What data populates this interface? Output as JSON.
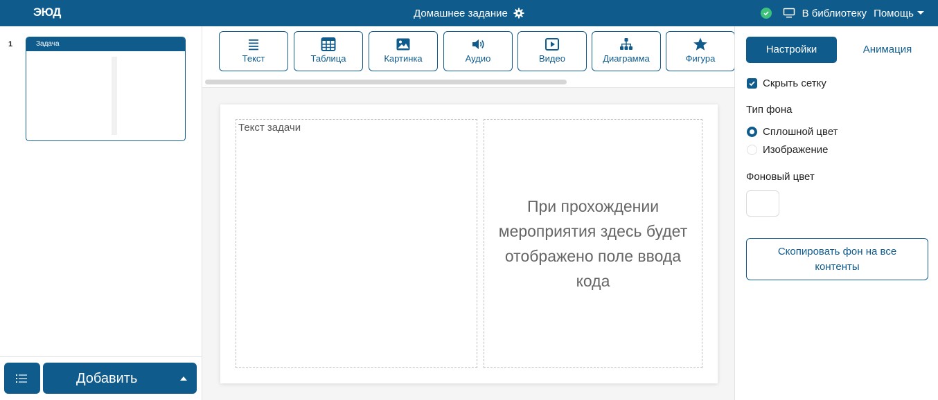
{
  "header": {
    "logo": "ЭЮД",
    "title": "Домашнее задание",
    "library_link": "В библиотеку",
    "help_menu": "Помощь"
  },
  "sidebar": {
    "slides": [
      {
        "number": "1",
        "title": "Задача"
      }
    ],
    "add_button": "Добавить"
  },
  "toolbar": {
    "tools": [
      {
        "label": "Текст",
        "icon": "lines-icon"
      },
      {
        "label": "Таблица",
        "icon": "table-icon"
      },
      {
        "label": "Картинка",
        "icon": "image-icon"
      },
      {
        "label": "Аудио",
        "icon": "speaker-icon"
      },
      {
        "label": "Видео",
        "icon": "play-icon"
      },
      {
        "label": "Диаграмма",
        "icon": "hierarchy-icon"
      },
      {
        "label": "Фигура",
        "icon": "star-icon"
      }
    ]
  },
  "canvas": {
    "task_text_placeholder": "Текст задачи",
    "code_field_message": "При прохождении мероприятия здесь будет отображено поле ввода кода"
  },
  "settings": {
    "tab_settings": "Настройки",
    "tab_animation": "Анимация",
    "hide_grid_label": "Скрыть сетку",
    "hide_grid_checked": true,
    "bg_type_label": "Тип фона",
    "bg_options": [
      {
        "label": "Сплошной цвет",
        "selected": true
      },
      {
        "label": "Изображение",
        "selected": false
      }
    ],
    "bg_color_label": "Фоновый цвет",
    "bg_color": "#ffffff",
    "copy_bg_button": "Скопировать фон на все контенты"
  },
  "colors": {
    "primary": "#0f5b8c",
    "success": "#3cc27a"
  }
}
